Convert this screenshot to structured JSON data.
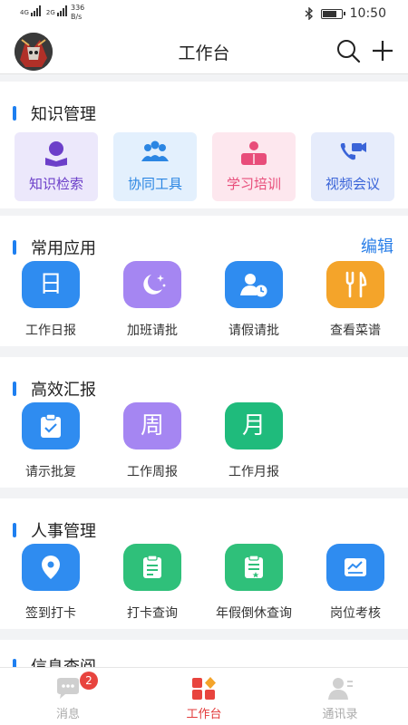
{
  "status_bar": {
    "network_1": "4G",
    "network_2": "2G",
    "speed_value": "336",
    "speed_unit": "B/s",
    "time": "10:50",
    "battery_level": 0.8
  },
  "header": {
    "title": "工作台"
  },
  "sections": {
    "knowledge": {
      "title": "知识管理",
      "cards": [
        {
          "label": "知识检索",
          "icon": "reader-icon",
          "bg": "#ece8fb",
          "color": "#6c3fc9"
        },
        {
          "label": "协同工具",
          "icon": "team-icon",
          "bg": "#e3f0fd",
          "color": "#2b86e3"
        },
        {
          "label": "学习培训",
          "icon": "learning-icon",
          "bg": "#fde7ee",
          "color": "#e84d7a"
        },
        {
          "label": "视频会议",
          "icon": "video-icon",
          "bg": "#e6ecfb",
          "color": "#3a64d8"
        }
      ]
    },
    "common": {
      "title": "常用应用",
      "edit_label": "编辑",
      "apps": [
        {
          "label": "工作日报",
          "glyph": "日",
          "icon": "daily-report-icon",
          "color": "#2f8cf0"
        },
        {
          "label": "加班请批",
          "icon": "moon-icon",
          "color": "#a586f2"
        },
        {
          "label": "请假请批",
          "icon": "leave-icon",
          "color": "#2f8cf0"
        },
        {
          "label": "查看菜谱",
          "icon": "fork-knife-icon",
          "color": "#f4a42a"
        }
      ]
    },
    "reports": {
      "title": "高效汇报",
      "apps": [
        {
          "label": "请示批复",
          "icon": "clipboard-check-icon",
          "color": "#2f8cf0"
        },
        {
          "label": "工作周报",
          "glyph": "周",
          "icon": "weekly-report-icon",
          "color": "#a586f2"
        },
        {
          "label": "工作月报",
          "glyph": "月",
          "icon": "monthly-report-icon",
          "color": "#1fbb7c"
        }
      ]
    },
    "hr": {
      "title": "人事管理",
      "apps": [
        {
          "label": "签到打卡",
          "icon": "location-icon",
          "color": "#2f8cf0"
        },
        {
          "label": "打卡查询",
          "icon": "checkin-query-icon",
          "color": "#2fc07a"
        },
        {
          "label": "年假倒休查询",
          "icon": "leave-query-icon",
          "color": "#2fc07a"
        },
        {
          "label": "岗位考核",
          "icon": "assessment-icon",
          "color": "#2f8cf0"
        }
      ]
    },
    "info": {
      "title": "信息查阅"
    }
  },
  "tabbar": {
    "tabs": [
      {
        "label": "消息",
        "icon": "message-icon",
        "badge": "2"
      },
      {
        "label": "工作台",
        "icon": "workbench-icon",
        "active": true
      },
      {
        "label": "通讯录",
        "icon": "contacts-icon"
      }
    ]
  }
}
